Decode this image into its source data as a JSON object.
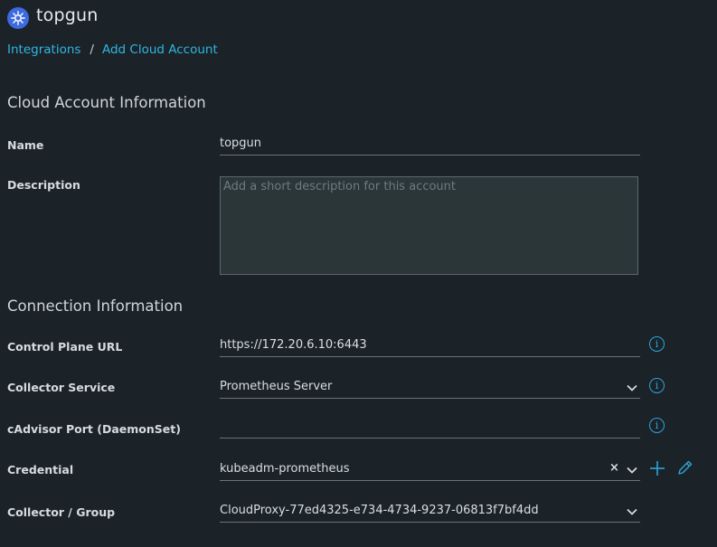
{
  "app": {
    "title": "topgun"
  },
  "breadcrumb": {
    "items": [
      "Integrations",
      "Add Cloud Account"
    ],
    "separator": "/"
  },
  "sections": {
    "cloud_account": "Cloud Account Information",
    "connection": "Connection Information"
  },
  "form": {
    "name": {
      "label": "Name",
      "value": "topgun"
    },
    "description": {
      "label": "Description",
      "placeholder": "Add a short description for this account",
      "value": ""
    },
    "control_plane_url": {
      "label": "Control Plane URL",
      "value": "https://172.20.6.10:6443"
    },
    "collector_service": {
      "label": "Collector Service",
      "value": "Prometheus Server"
    },
    "cadvisor_port": {
      "label": "cAdvisor Port (DaemonSet)",
      "value": ""
    },
    "credential": {
      "label": "Credential",
      "value": "kubeadm-prometheus",
      "clear_glyph": "×"
    },
    "collector_group": {
      "label": "Collector / Group",
      "value": "CloudProxy-77ed4325-e734-4734-9237-06813f7bf4dd"
    }
  },
  "icons": {
    "info_glyph": "i"
  },
  "colors": {
    "background": "#1b2329",
    "accent": "#31b6e0",
    "logo": "#3d6ae0"
  }
}
